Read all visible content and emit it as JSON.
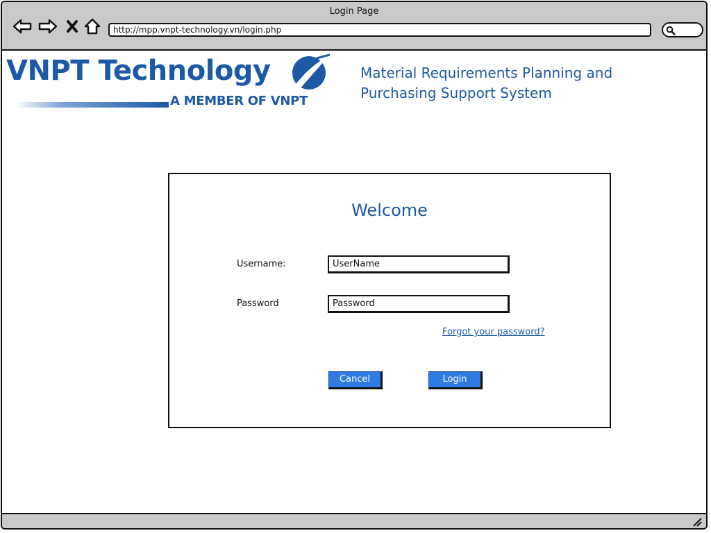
{
  "window": {
    "title": "Login Page",
    "url": "http://mpp.vnpt-technology.vn/login.php"
  },
  "icons": {
    "back": "back-arrow-icon",
    "forward": "forward-arrow-icon",
    "close": "close-icon",
    "home": "home-icon",
    "search": "search-icon",
    "resize": "resize-grip-icon"
  },
  "header": {
    "logo_name": "VNPT Technology",
    "logo_tagline": "A MEMBER OF VNPT",
    "system_title_line1": "Material Requirements Planning and",
    "system_title_line2": "Purchasing Support System"
  },
  "login": {
    "heading": "Welcome",
    "username_label": "Username:",
    "username_value": "UserName",
    "password_label": "Password",
    "password_value": "Password",
    "forgot_link": "Forgot your password?",
    "cancel_label": "Cancel",
    "login_label": "Login"
  },
  "colors": {
    "brand": "#1c5aa6",
    "button": "#2f7be4",
    "chrome": "#c9c9c9"
  }
}
